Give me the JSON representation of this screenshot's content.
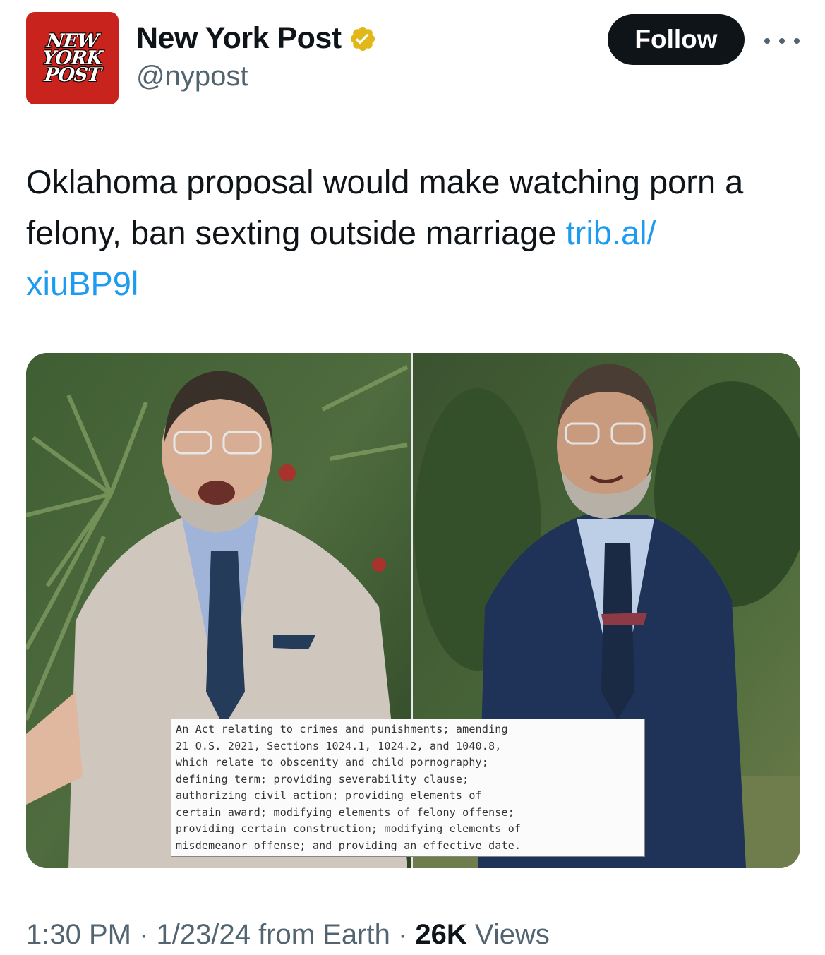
{
  "account": {
    "logo_lines": [
      "NEW",
      "YORK",
      "POST"
    ],
    "display_name": "New York Post",
    "handle": "@nypost",
    "verified_icon": "gold-verified-badge-icon",
    "follow_label": "Follow",
    "more_icon": "more-dots-icon"
  },
  "tweet": {
    "text": "Oklahoma proposal would make watching porn a felony, ban sexting outside marriage ",
    "link": "trib.al/\nxiuBP9l"
  },
  "media": {
    "document_lines": [
      "An Act relating to crimes and punishments; amending",
      "21 O.S. 2021, Sections 1024.1, 1024.2, and 1040.8,",
      "which relate to obscenity and child pornography;",
      "defining term; providing severability clause;",
      "authorizing civil action; providing elements of",
      "certain award; modifying elements of felony offense;",
      "providing certain construction; modifying elements of",
      "misdemeanor offense; and providing an effective date."
    ]
  },
  "meta": {
    "time": "1:30 PM",
    "sep1": " · ",
    "date": "1/23/24",
    "location": " from Earth",
    "sep2": " · ",
    "views_count": "26K",
    "views_label": " Views"
  },
  "colors": {
    "brand_red": "#c8231c",
    "link_blue": "#1d9bf0",
    "verified_gold": "#e2b719",
    "muted_text": "#536471"
  }
}
